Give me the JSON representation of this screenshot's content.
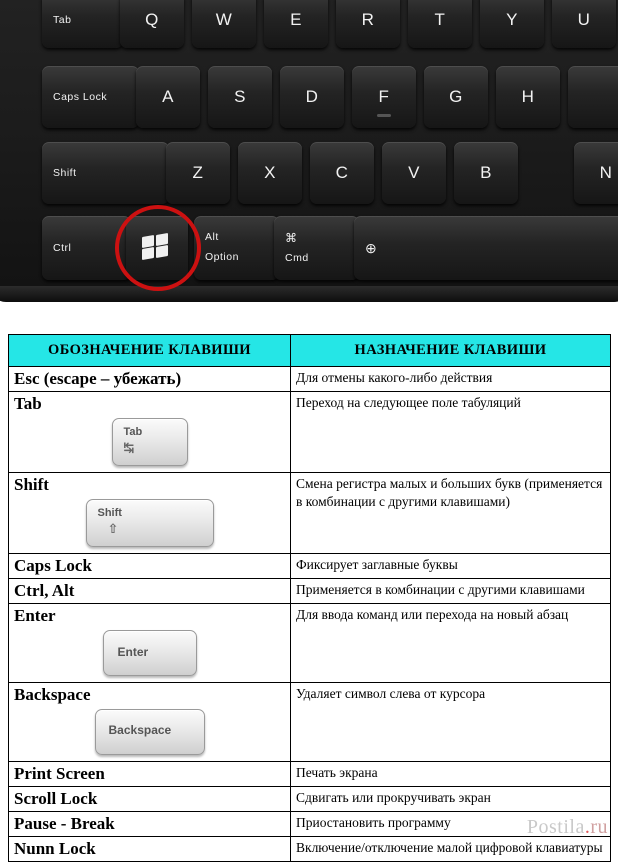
{
  "photo": {
    "alt": "keyboard-photo",
    "keys": [
      {
        "id": "tab",
        "label": "Tab"
      },
      {
        "id": "q",
        "label": "Q"
      },
      {
        "id": "w",
        "label": "W"
      },
      {
        "id": "e",
        "label": "E"
      },
      {
        "id": "r",
        "label": "R"
      },
      {
        "id": "t",
        "label": "T"
      },
      {
        "id": "y",
        "label": "Y"
      },
      {
        "id": "u",
        "label": "U"
      },
      {
        "id": "capslock",
        "label": "Caps Lock"
      },
      {
        "id": "a",
        "label": "A"
      },
      {
        "id": "s",
        "label": "S"
      },
      {
        "id": "d",
        "label": "D"
      },
      {
        "id": "f",
        "label": "F"
      },
      {
        "id": "g",
        "label": "G"
      },
      {
        "id": "h",
        "label": "H"
      },
      {
        "id": "shift",
        "label": "Shift"
      },
      {
        "id": "z",
        "label": "Z"
      },
      {
        "id": "x",
        "label": "X"
      },
      {
        "id": "c",
        "label": "C"
      },
      {
        "id": "v",
        "label": "V"
      },
      {
        "id": "b",
        "label": "B"
      },
      {
        "id": "n",
        "label": "N"
      },
      {
        "id": "ctrl",
        "label": "Ctrl"
      },
      {
        "id": "alt",
        "label": "Alt",
        "label2": "Option"
      },
      {
        "id": "cmd",
        "label": "⌘",
        "label2": "Cmd"
      },
      {
        "id": "globe",
        "label": "⊕"
      }
    ],
    "highlight_color": "#cc1111"
  },
  "table": {
    "headers": [
      "ОБОЗНАЧЕНИЕ КЛАВИШИ",
      "НАЗНАЧЕНИЕ КЛАВИШИ"
    ],
    "header_bg": "#25e6e6",
    "rows": [
      {
        "name": "Esc (escape – убежать)",
        "desc": "Для отмены какого-либо действия",
        "keycap": null
      },
      {
        "name": "Tab",
        "desc": "Переход на следующее поле табуляций",
        "keycap": {
          "text": "Tab",
          "symbol": "↹"
        }
      },
      {
        "name": "Shift",
        "desc": "Смена регистра малых и больших букв (применяется в комбинации с другими клавишами)",
        "keycap": {
          "text": "Shift",
          "symbol": "⇧"
        }
      },
      {
        "name": "Caps Lock",
        "desc": "Фиксирует заглавные буквы",
        "keycap": null
      },
      {
        "name": "Ctrl, Alt",
        "desc": "Применяется в комбинации с другими клавишами",
        "keycap": null
      },
      {
        "name": "Enter",
        "desc": "Для ввода команд или перехода на новый абзац",
        "keycap": {
          "text": "Enter",
          "symbol": ""
        }
      },
      {
        "name": "Backspace",
        "desc": "Удаляет символ слева от курсора",
        "keycap": {
          "text": "Backspace",
          "symbol": ""
        }
      },
      {
        "name": "Print Screen",
        "desc": "Печать экрана",
        "keycap": null
      },
      {
        "name": "Scroll Lock",
        "desc": "Сдвигать или прокручивать экран",
        "keycap": null
      },
      {
        "name": "Pause - Break",
        "desc": "Приостановить программу",
        "keycap": null
      },
      {
        "name": "Nunn Lock",
        "desc": "Включение/отключение малой цифровой клавиатуры",
        "keycap": null
      }
    ]
  },
  "watermark": {
    "part1": "Postila",
    "dot": ".",
    "part2": "ru"
  }
}
